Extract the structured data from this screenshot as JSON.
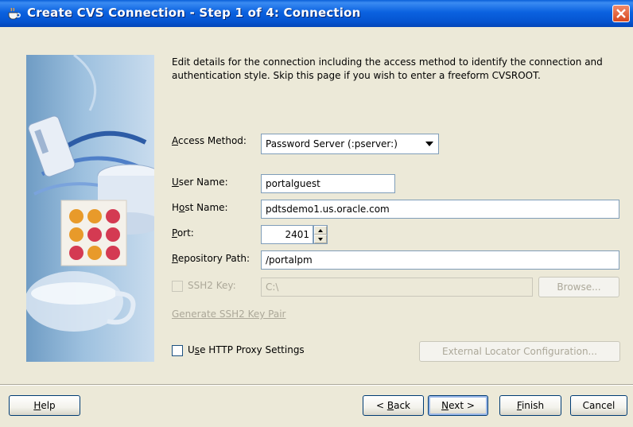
{
  "window": {
    "title": "Create CVS Connection - Step 1 of 4: Connection"
  },
  "description": "Edit details for the connection including the access method to identify the connection and authentication style. Skip this page if you wish to enter a freeform CVSROOT.",
  "form": {
    "access_method": {
      "label_u": "A",
      "label_rest": "ccess Method:",
      "value": "Password Server (:pserver:)"
    },
    "user_name": {
      "label_u": "U",
      "label_rest": "ser Name:",
      "value": "portalguest"
    },
    "host_name": {
      "label_pre": "H",
      "label_u": "o",
      "label_rest": "st Name:",
      "value": "pdtsdemo1.us.oracle.com"
    },
    "port": {
      "label_u": "P",
      "label_rest": "ort:",
      "value": "2401"
    },
    "repository_path": {
      "label_u": "R",
      "label_rest": "epository Path:",
      "value": "/portalpm"
    },
    "ssh2_key": {
      "label": "SSH2 Key:",
      "value": "C:\\",
      "browse_label": "Browse...",
      "checked": false,
      "enabled": false
    },
    "generate_link": "Generate SSH2 Key Pair",
    "http_proxy": {
      "label_pre": "U",
      "label_u": "s",
      "label_rest": "e HTTP Proxy Settings",
      "checked": false
    },
    "external_locator_label": "External Locator Configuration..."
  },
  "buttons": {
    "help": {
      "u": "H",
      "rest": "elp"
    },
    "back": {
      "pre": "< ",
      "u": "B",
      "rest": "ack"
    },
    "next": {
      "u": "N",
      "rest": "ext >"
    },
    "finish": {
      "u": "F",
      "rest": "inish"
    },
    "cancel": "Cancel"
  },
  "colors": {
    "titlebar": "#0554d0",
    "dialog_bg": "#ece9d8",
    "disabled_text": "#aca899"
  }
}
